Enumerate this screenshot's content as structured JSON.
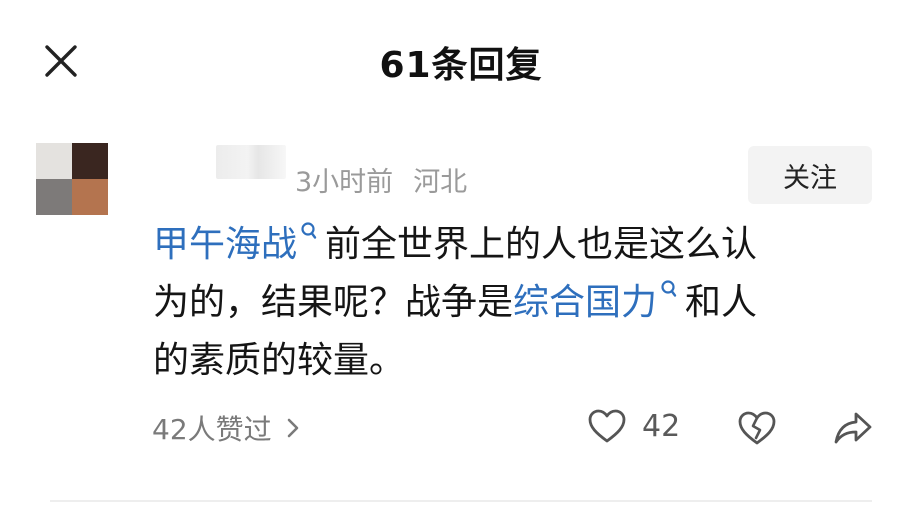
{
  "header": {
    "title": "61条回复",
    "close_icon": "close-icon"
  },
  "comment": {
    "time": "3小时前",
    "location": "河北",
    "follow_label": "关注",
    "line1_link": "甲午海战",
    "line1_text": "前全世界上的人也是这么认",
    "line2_text": "为的，结果呢？战争是",
    "line2_link": "综合国力",
    "line2_after": "和人",
    "line3_text": "的素质的较量。",
    "likers_text": "42人赞过",
    "like_count": "42"
  },
  "colors": {
    "link": "#2e6fbd",
    "meta": "#9a9a9a",
    "follow_bg": "#f3f3f3"
  },
  "icons": [
    "close-icon",
    "search-icon",
    "chevron-right-icon",
    "heart-icon",
    "broken-heart-icon",
    "share-icon"
  ]
}
